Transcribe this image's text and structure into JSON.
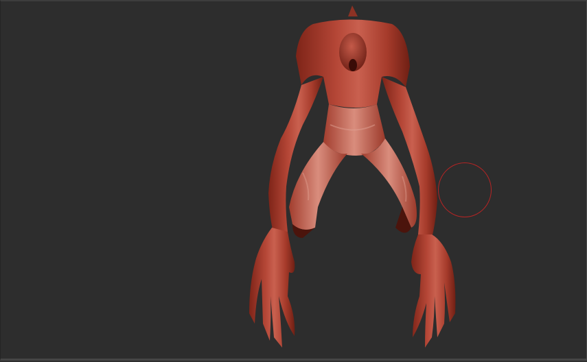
{
  "canvas": {
    "background_color": "#2d2d2d",
    "model_color": "#a83a2c",
    "model_highlight_color": "#cf6b5a",
    "model_shadow_color": "#5a1810",
    "brush_color": "#b82424"
  },
  "model": {
    "icon": "creature-sculpt-mesh"
  },
  "brush": {
    "icon": "brush-cursor-circle"
  }
}
